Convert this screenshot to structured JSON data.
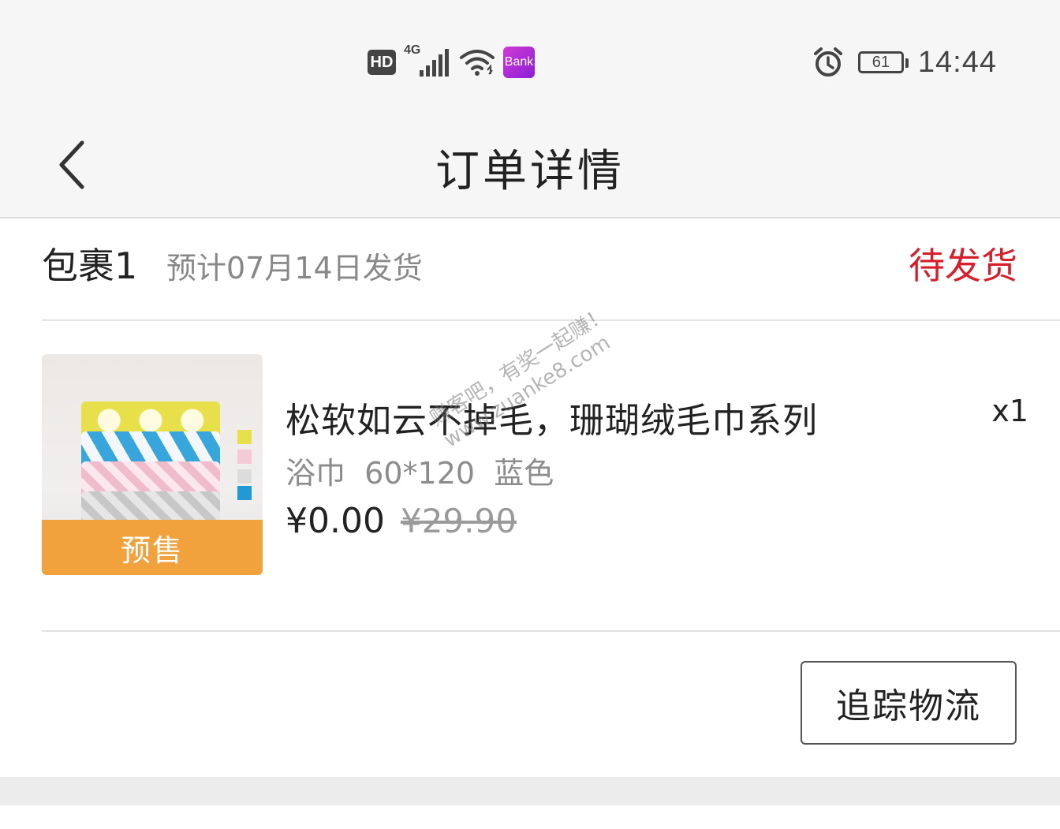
{
  "status_bar": {
    "hd_label": "HD",
    "network_label": "4G",
    "bank_label": "Bank",
    "battery": "61",
    "time": "14:44"
  },
  "nav": {
    "title": "订单详情"
  },
  "package": {
    "name": "包裹1",
    "eta": "预计07月14日发货",
    "status": "待发货"
  },
  "item": {
    "title": "松软如云不掉毛，珊瑚绒毛巾系列",
    "quantity": "x1",
    "spec": "浴巾  60*120  蓝色",
    "price": "¥0.00",
    "original_price": "¥29.90",
    "tag": "预售"
  },
  "watermark": {
    "line1": "赚客吧，有奖一起赚！",
    "line2": "www.zuanke8.com"
  },
  "actions": {
    "track_label": "追踪物流"
  },
  "colors": {
    "status_red": "#d81e2a",
    "presale_orange": "#f1a23c"
  }
}
